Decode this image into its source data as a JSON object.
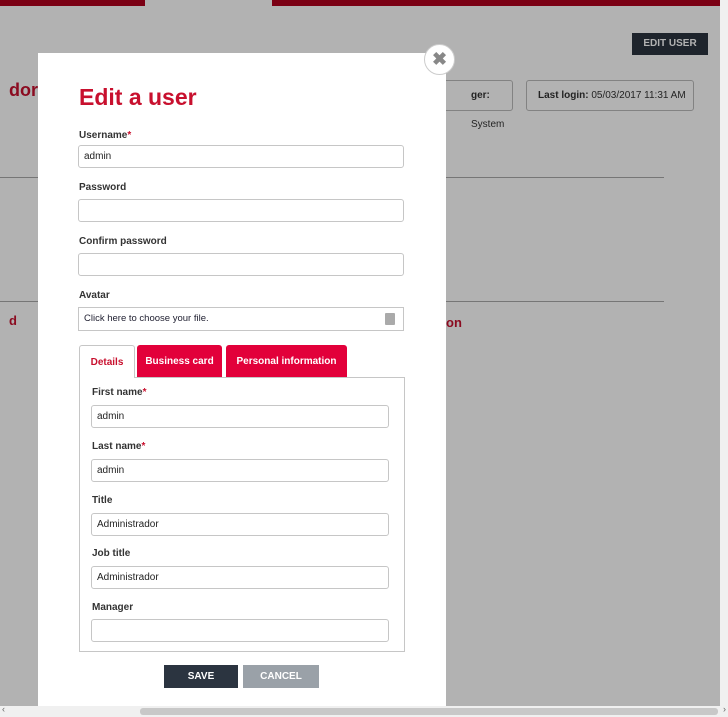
{
  "background": {
    "edit_user_button": "EDIT USER",
    "title_fragment": "dor",
    "manager_label": "ger:",
    "manager_value": "System",
    "last_login_label": "Last login:",
    "last_login_value": "05/03/2017 11:31 AM",
    "section_fragment_left": "d",
    "section_fragment_right": "on"
  },
  "modal": {
    "title": "Edit a user",
    "close_glyph": "✖",
    "username": {
      "label": "Username",
      "required_mark": "*",
      "value": "admin"
    },
    "password": {
      "label": "Password",
      "value": ""
    },
    "confirm_password": {
      "label": "Confirm password",
      "value": ""
    },
    "avatar": {
      "label": "Avatar",
      "file_text": "Click here to choose your file.",
      "icon": "file-icon"
    },
    "tabs": [
      {
        "label": "Details",
        "active": true
      },
      {
        "label": "Business card",
        "active": false
      },
      {
        "label": "Personal information",
        "active": false
      }
    ],
    "details": {
      "first_name": {
        "label": "First name",
        "required_mark": "*",
        "value": "admin"
      },
      "last_name": {
        "label": "Last name",
        "required_mark": "*",
        "value": "admin"
      },
      "title": {
        "label": "Title",
        "value": "Administrador"
      },
      "job_title": {
        "label": "Job title",
        "value": "Administrador"
      },
      "manager": {
        "label": "Manager",
        "value": ""
      }
    },
    "save_label": "SAVE",
    "cancel_label": "CANCEL"
  },
  "colors": {
    "brand_red": "#c8102e",
    "tab_red": "#e2003a",
    "dark_button": "#2b3440",
    "cancel_button": "#9aa1a8"
  }
}
